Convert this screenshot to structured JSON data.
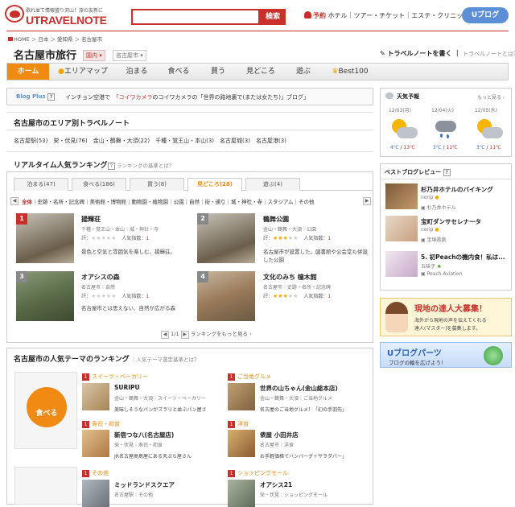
{
  "header": {
    "tagline": "歌れ並て情報盛り沢山！旅の友新に",
    "logo_text": "UTRAVELNOTE",
    "search_button": "検索",
    "top_links": {
      "yoyaku": "予約",
      "hotel": "ホテル",
      "tour": "ツアー・チケット",
      "este": "エステ・クリニック"
    },
    "ublog": "Uブログ"
  },
  "breadcrumb": [
    "HOME",
    "日本",
    "愛知県",
    "名古屋市"
  ],
  "page": {
    "title": "名古屋市旅行",
    "tag_kunai": "国内",
    "tag_city": "名古屋市",
    "write_note": "トラベルノートを書く",
    "write_note_sub": "トラベルノートとは？"
  },
  "nav": [
    "ホーム",
    "エリアマップ",
    "泊まる",
    "食べる",
    "買う",
    "見どころ",
    "遊ぶ",
    "Best100"
  ],
  "blogplus": {
    "label": "Blog Plus",
    "q": "?",
    "text_a": "インチョン空港で",
    "text_red": "「コイワカメラ",
    "text_b": "のコイワカメラの「世界の路地裏で(または女たち)」ブログ」"
  },
  "area": {
    "title": "名古屋市のエリア別トラベルノート",
    "links": [
      "名古屋駅(53)",
      "栄・伏見(76)",
      "金山・鶴舞・大須(22)",
      "千種・覚王山・本山(3)",
      "名古屋城(3)",
      "名古屋港(3)"
    ]
  },
  "ranking": {
    "title": "リアルタイム人気ランキング",
    "sub": "ランキングの基準とは？",
    "tabs": [
      "泊まる(47)",
      "食べる(186)",
      "買う(8)",
      "見どころ(28)",
      "遊ぶ(4)"
    ],
    "subcats": [
      "全体",
      "史跡・名所・記念碑",
      "美術館・博物館",
      "動物園・植物園",
      "公園",
      "自然",
      "街・通り",
      "城・神社・寺",
      "スタジアム",
      "その他"
    ],
    "items": [
      {
        "rank": "1",
        "name": "揚輝荘",
        "meta": "千種・覚王山・本山｜城・神社・寺",
        "rating_label": "評：",
        "pop": "人気指数：",
        "pop_val": "1",
        "desc": "景色と空気と雰囲気を楽しむ、揚輝荘。"
      },
      {
        "rank": "2",
        "name": "鶴舞公園",
        "meta": "金山・鶴舞・大須｜公園",
        "rating_label": "評：",
        "pop": "人気指数：",
        "pop_val": "1",
        "desc": "名古屋市が設置した、図書館や公会堂も併設した公園"
      },
      {
        "rank": "3",
        "name": "オアシスの森",
        "meta": "名古屋市｜自然",
        "rating_label": "評：",
        "pop": "人気指数：",
        "pop_val": "1",
        "desc": "名古屋市とは思えない、自然が広がる森"
      },
      {
        "rank": "4",
        "name": "文化のみち 橦木館",
        "meta": "名古屋市｜史跡・名所・記念碑",
        "rating_label": "評：",
        "pop": "人気指数：",
        "pop_val": "1",
        "desc": ""
      }
    ],
    "pager": "1/1",
    "more": "ランキングをもっと見る ›"
  },
  "theme": {
    "title": "名古屋市の人気テーマのランキング",
    "sub": "人気テーマ選定基準とは？",
    "icon_label": "食べる",
    "items": [
      {
        "num": "1",
        "cat": "スイーツ・ベーカリー",
        "name": "SURIPU",
        "meta": "金山・鶴舞・大須｜スイーツ・ベーカリー",
        "desc": "美味しそうなパンがズラリと並ぶパン屋さ"
      },
      {
        "num": "1",
        "cat": "ご当地グルメ",
        "name": "世界の山ちゃん(金山総本店)",
        "meta": "金山・鶴舞・大須｜ご当地グルメ",
        "desc": "名古屋のご当地グルメ！「幻の手羽先」"
      },
      {
        "num": "1",
        "cat": "寿司・和食",
        "name": "新宿つな八(名古屋店)",
        "meta": "栄・伏見｜寿司・和食",
        "desc": "JR名古屋高島屋にある天ぷら屋さん"
      },
      {
        "num": "1",
        "cat": "洋食",
        "name": "俵屋 小田井店",
        "meta": "名古屋市｜洋食",
        "desc": "お手軽価格でハンバーグ＋サラダバー」"
      },
      {
        "num": "1",
        "cat": "その他",
        "name": "ミッドランドスクエア",
        "meta": "名古屋駅｜その他",
        "desc": ""
      },
      {
        "num": "1",
        "cat": "ショッピングモール",
        "name": "オアシス21",
        "meta": "栄・伏見｜ショッピングモール",
        "desc": ""
      }
    ]
  },
  "weather": {
    "title": "天気予報",
    "more": "もっと見る",
    "days": [
      {
        "date": "12/03(月)",
        "lo": "4℃",
        "hi": "13℃"
      },
      {
        "date": "12/04(火)",
        "lo": "3℃",
        "hi": "11℃"
      },
      {
        "date": "12/05(水)",
        "lo": "3℃",
        "hi": "11℃"
      }
    ]
  },
  "bestblog": {
    "title": "ベストブログレビュー",
    "q": "?",
    "items": [
      {
        "title": "杉乃井ホテルのバイキング",
        "user": "norip",
        "src": "杉乃井ホテル"
      },
      {
        "title": "宝町ダンサセレナータ",
        "user": "norip",
        "src": "宝塚歌劇"
      },
      {
        "title": "5. 初Peachの機内食！私は...",
        "user": "五味子",
        "src": "Peach Aviation"
      }
    ]
  },
  "banners": {
    "master_title": "現地の達人大募集！",
    "master_sub1": "海外から現地の声を伝えてくれる",
    "master_sub2": "達人(マスター)を募集します。",
    "parts_title": "Uブログパーツ",
    "parts_sub": "ブログの輪を広げよう！"
  },
  "colors": {
    "brand": "#c9302c",
    "accent": "#f08a12",
    "link_blue": "#5d8fd6"
  }
}
